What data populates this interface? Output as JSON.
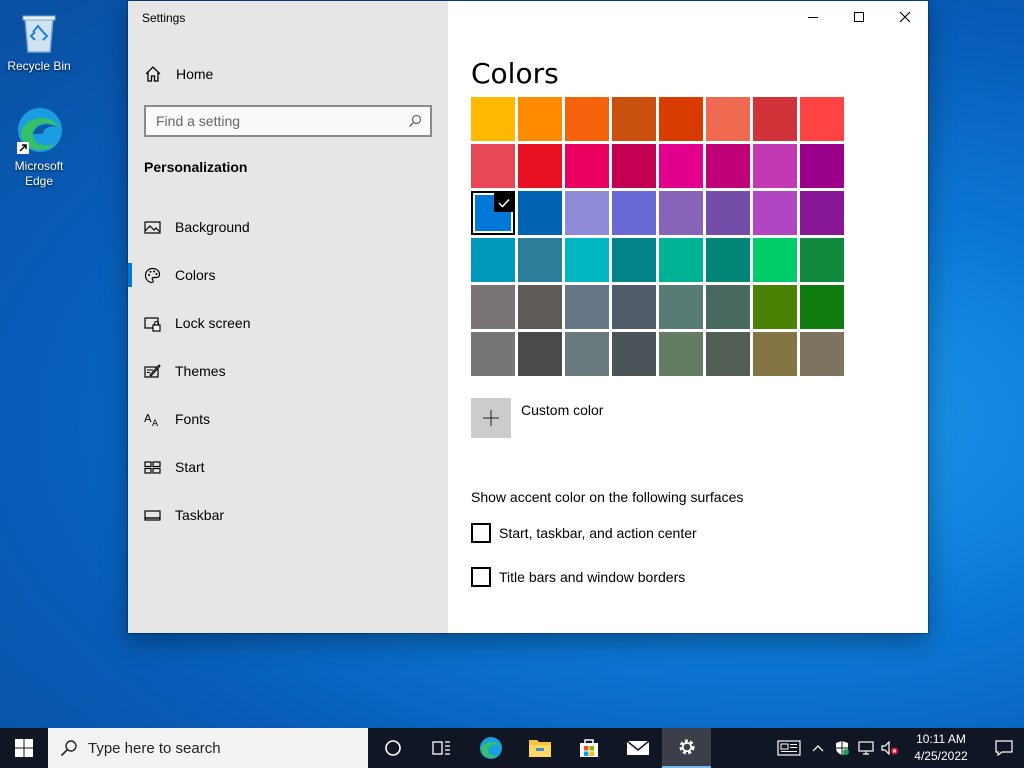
{
  "desktop": {
    "icons": [
      {
        "label": "Recycle Bin",
        "icon": "recycle-bin-icon"
      },
      {
        "label": "Microsoft\nEdge",
        "label_line1": "Microsoft",
        "label_line2": "Edge",
        "icon": "edge-icon"
      }
    ]
  },
  "window": {
    "title": "Settings",
    "controls": {
      "minimize": "minimize-icon",
      "maximize": "maximize-icon",
      "close": "close-icon"
    }
  },
  "sidebar": {
    "home_label": "Home",
    "search_placeholder": "Find a setting",
    "section_title": "Personalization",
    "items": [
      {
        "label": "Background",
        "icon": "picture-icon",
        "active": false
      },
      {
        "label": "Colors",
        "icon": "palette-icon",
        "active": true
      },
      {
        "label": "Lock screen",
        "icon": "lock-screen-icon",
        "active": false
      },
      {
        "label": "Themes",
        "icon": "themes-icon",
        "active": false
      },
      {
        "label": "Fonts",
        "icon": "fonts-icon",
        "active": false
      },
      {
        "label": "Start",
        "icon": "start-layout-icon",
        "active": false
      },
      {
        "label": "Taskbar",
        "icon": "taskbar-icon",
        "active": false
      }
    ],
    "accent_color": "#0078d7"
  },
  "content": {
    "title": "Colors",
    "swatches": [
      [
        "#ffb900",
        "#ff8c00",
        "#f7630c",
        "#ca5010",
        "#da3b01",
        "#ef6950",
        "#d13438",
        "#ff4343"
      ],
      [
        "#e74856",
        "#e81123",
        "#ea005e",
        "#c30052",
        "#e3008c",
        "#bf0077",
        "#c239b3",
        "#9a0089"
      ],
      [
        "#0078d7",
        "#0063b1",
        "#8e8cd8",
        "#6b69d6",
        "#8764b8",
        "#744da9",
        "#b146c2",
        "#881798"
      ],
      [
        "#0099bc",
        "#2d7d9a",
        "#00b7c3",
        "#038387",
        "#00b294",
        "#018574",
        "#00cc6a",
        "#10893e"
      ],
      [
        "#7a7574",
        "#5d5a58",
        "#68768a",
        "#515c6b",
        "#567c73",
        "#486860",
        "#498205",
        "#107c10"
      ],
      [
        "#767676",
        "#4c4a48",
        "#69797e",
        "#4a5459",
        "#647c64",
        "#525e54",
        "#847545",
        "#7e735f"
      ]
    ],
    "selected_swatch": {
      "row": 2,
      "col": 0
    },
    "custom_color_label": "Custom color",
    "accent_surfaces_heading": "Show accent color on the following surfaces",
    "checkboxes": [
      {
        "label": "Start, taskbar, and action center",
        "checked": false
      },
      {
        "label": "Title bars and window borders",
        "checked": false
      }
    ]
  },
  "taskbar": {
    "search_placeholder": "Type here to search",
    "apps": [
      "cortana-icon",
      "task-view-icon",
      "edge-icon",
      "file-explorer-icon",
      "store-icon",
      "mail-icon",
      "settings-icon"
    ],
    "active_app": "settings-icon",
    "tray_icons": [
      "news-icon",
      "chevron-up-icon",
      "security-icon",
      "network-icon",
      "volume-muted-icon"
    ],
    "clock_time": "10:11 AM",
    "clock_date": "4/25/2022"
  }
}
